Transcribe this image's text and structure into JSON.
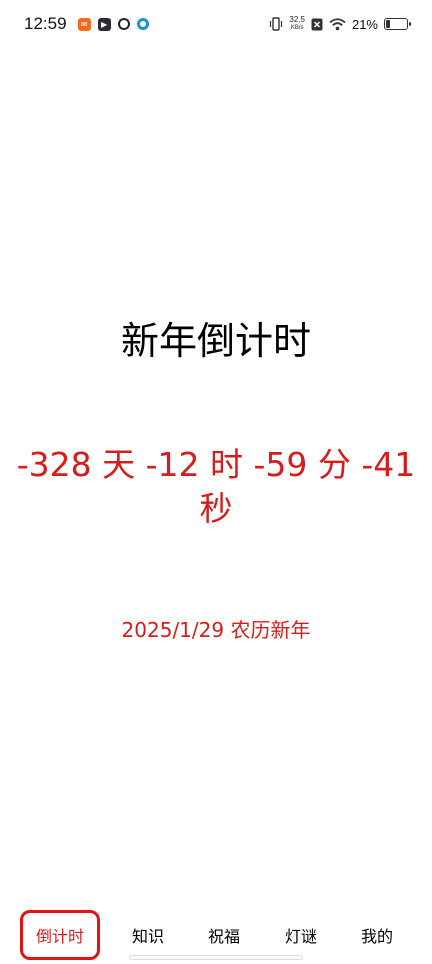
{
  "status_bar": {
    "time": "12:59",
    "net_speed_value": "32.5",
    "net_speed_unit": "KB/s",
    "battery_percent": "21%",
    "battery_level": 0.21,
    "icons": [
      "orange-app-icon",
      "play-icon",
      "link-icon",
      "browser-icon",
      "vibrate-icon",
      "sim-off-icon",
      "wifi-icon",
      "battery-icon"
    ]
  },
  "main": {
    "title": "新年倒计时",
    "countdown": "-328 天 -12 时 -59 分 -41 秒",
    "date_line": "2025/1/29 农历新年"
  },
  "bottom_nav": {
    "items": [
      {
        "label": "倒计时",
        "active": true
      },
      {
        "label": "知识",
        "active": false
      },
      {
        "label": "祝福",
        "active": false
      },
      {
        "label": "灯谜",
        "active": false
      },
      {
        "label": "我的",
        "active": false
      }
    ]
  },
  "colors": {
    "accent": "#d81b1b",
    "text": "#000000",
    "background": "#ffffff"
  }
}
